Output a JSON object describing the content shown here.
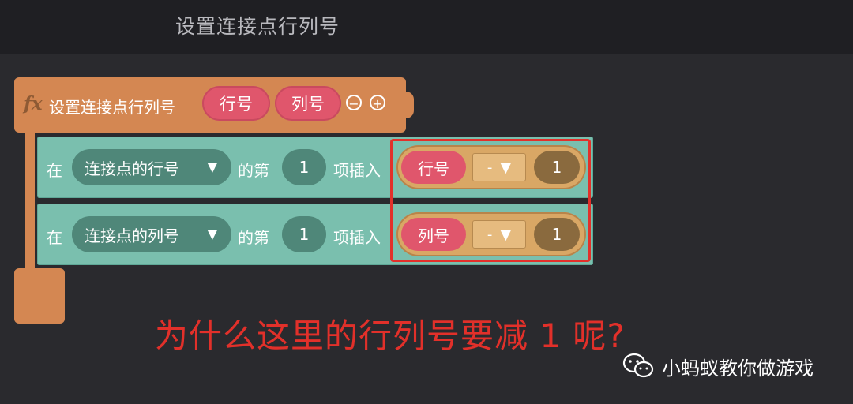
{
  "header": {
    "title": "设置连接点行列号"
  },
  "function_block": {
    "icon": "fx",
    "name": "设置连接点行列号",
    "params": [
      "行号",
      "列号"
    ],
    "minus": "⊖",
    "plus": "⊕"
  },
  "statements": [
    {
      "prefix": "在",
      "list": "连接点的行号",
      "mid": "的第",
      "index": "1",
      "action": "项插入",
      "expr": {
        "var": "行号",
        "op": "-",
        "value": "1"
      }
    },
    {
      "prefix": "在",
      "list": "连接点的列号",
      "mid": "的第",
      "index": "1",
      "action": "项插入",
      "expr": {
        "var": "列号",
        "op": "-",
        "value": "1"
      }
    }
  ],
  "annotation": {
    "question": "为什么这里的行列号要减 1 呢?",
    "color": "#e2302a"
  },
  "watermark": {
    "text": "小蚂蚁教你做游戏",
    "icon": "wechat-icon"
  },
  "colors": {
    "procedure": "#d48752",
    "list_block": "#7abfae",
    "variable": "#e0566c",
    "math": "#d9a765"
  }
}
